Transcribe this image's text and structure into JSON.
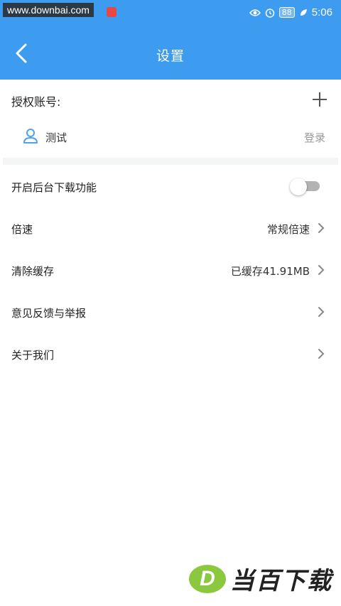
{
  "status_bar": {
    "watermark": "www.downbai.com",
    "battery": "88",
    "time": "5:06",
    "icons": [
      "eye-icon",
      "alarm-icon",
      "battery-icon",
      "leaf-icon"
    ]
  },
  "header": {
    "title": "设置",
    "background_color": "#3d9bf0"
  },
  "account": {
    "label": "授权账号:",
    "add_icon": "plus-icon",
    "user_name": "测试",
    "login_label": "登录"
  },
  "settings": {
    "background_download": {
      "label": "开启后台下载功能",
      "enabled": false
    },
    "speed": {
      "label": "倍速",
      "value": "常规倍速"
    },
    "clear_cache": {
      "label": "清除缓存",
      "value": "已缓存41.91MB"
    },
    "feedback": {
      "label": "意见反馈与举报"
    },
    "about": {
      "label": "关于我们"
    }
  },
  "brand": {
    "logo_letter": "D",
    "text": "当百下载",
    "logo_color": "#8cc83f"
  }
}
